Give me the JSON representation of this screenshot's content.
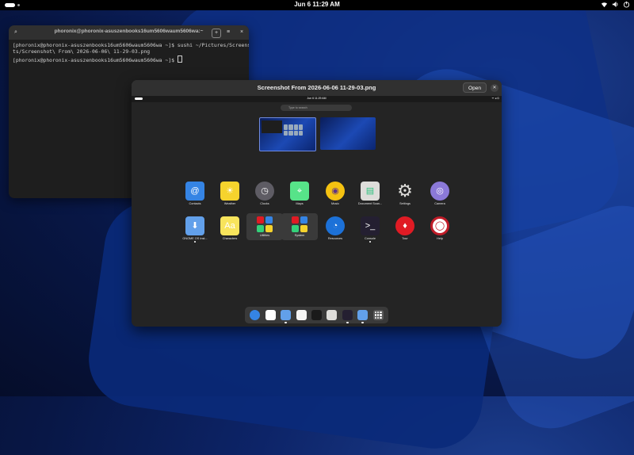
{
  "topbar": {
    "clock": "Jun 6  11:29 AM",
    "tray_icons": [
      "wifi-icon",
      "volume-icon",
      "power-icon"
    ]
  },
  "terminal": {
    "title": "phoronix@phoronix-asuszenbooks16um5606waum5606wa:~",
    "lines": [
      "[phoronix@phoronix-asuszenbooks16um5606waum5606wa ~]$ sushi ~/Pictures/Screensho",
      "ts/Screenshot\\ From\\ 2026-06-06\\ 11-29-03.png",
      "[phoronix@phoronix-asuszenbooks16um5606waum5606wa ~]$ "
    ]
  },
  "viewer": {
    "title": "Screenshot From 2026-06-06 11-29-03.png",
    "open_label": "Open"
  },
  "shot": {
    "clock": "Jun 6  11:29 AM",
    "search_placeholder": "Type to search",
    "apps": [
      {
        "label": "Contacts",
        "color": "#3584e4",
        "glyph": "@"
      },
      {
        "label": "Weather",
        "color": "#f6d32d",
        "glyph": "☀"
      },
      {
        "label": "Clocks",
        "color": "#5e5c64",
        "glyph": "◷"
      },
      {
        "label": "Maps",
        "color": "#57e389",
        "glyph": "⌖"
      },
      {
        "label": "Music",
        "color": "#f5c211",
        "glyph": "◉"
      },
      {
        "label": "Document Scan...",
        "color": "#deddda",
        "glyph": "▤"
      },
      {
        "label": "Settings",
        "color": "#9a9996",
        "glyph": "⚙"
      },
      {
        "label": "Camera",
        "color": "#8b79d8",
        "glyph": "◎"
      },
      {
        "label": "GNOME OS Inst...",
        "color": "#62a0ea",
        "glyph": "⬇"
      },
      {
        "label": "Characters",
        "color": "#f8e45c",
        "glyph": "Aa"
      },
      {
        "label": "Utilities",
        "color": "#3a3a3a",
        "glyph": "▦"
      },
      {
        "label": "System",
        "color": "#3a3a3a",
        "glyph": "▦"
      },
      {
        "label": "Resources",
        "color": "#1c71d8",
        "glyph": "◔"
      },
      {
        "label": "Console",
        "color": "#241f31",
        "glyph": ">_"
      },
      {
        "label": "Tour",
        "color": "#e01b24",
        "glyph": "♦"
      },
      {
        "label": "Help",
        "color": "#c01c28",
        "glyph": "◯"
      }
    ],
    "dock": [
      {
        "name": "web",
        "color": "#3584e4",
        "running": false
      },
      {
        "name": "calendar",
        "color": "#ffffff",
        "running": false
      },
      {
        "name": "phone",
        "color": "#62a0ea",
        "running": true
      },
      {
        "name": "software",
        "color": "#f6f5f4",
        "running": false
      },
      {
        "name": "files",
        "color": "#1a1a1a",
        "running": false
      },
      {
        "name": "calculator",
        "color": "#deddda",
        "running": false
      },
      {
        "name": "terminal",
        "color": "#241f31",
        "running": true
      },
      {
        "name": "installer",
        "color": "#62a0ea",
        "running": true
      },
      {
        "name": "app-grid",
        "color": "#5a5a5a",
        "running": false
      }
    ]
  }
}
